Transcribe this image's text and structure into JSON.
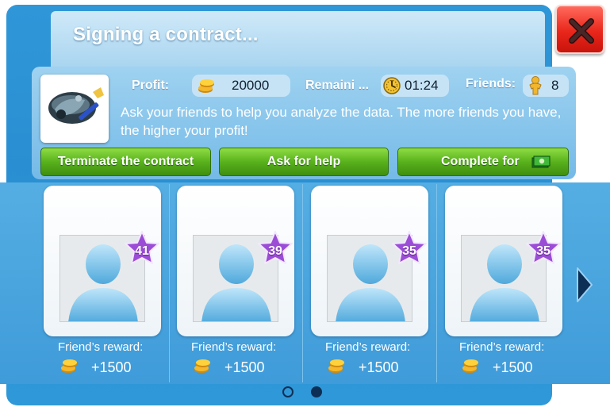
{
  "dialog": {
    "title": "Signing a contract...",
    "close_icon": "close-x-icon"
  },
  "info": {
    "profit_label": "Profit:",
    "profit_value": "20000",
    "remaining_label": "Remaini ...",
    "remaining_time": "01:24",
    "friends_label": "Friends:",
    "friends_count": "8",
    "description": "Ask your friends to help you analyze the data. The more friends you have, the higher your profit!"
  },
  "buttons": {
    "terminate": "Terminate the contract",
    "ask_help": "Ask for help",
    "complete": "Complete for"
  },
  "friends": [
    {
      "level": "41",
      "reward_label": "Friend’s reward:",
      "reward": "+1500"
    },
    {
      "level": "39",
      "reward_label": "Friend’s reward:",
      "reward": "+1500"
    },
    {
      "level": "35",
      "reward_label": "Friend’s reward:",
      "reward": "+1500"
    },
    {
      "level": "35",
      "reward_label": "Friend’s reward:",
      "reward": "+1500"
    }
  ],
  "pagination": {
    "pages": 2,
    "current": 2
  },
  "colors": {
    "panel_blue": "#2f97d8",
    "button_green": "#58b21c",
    "close_red": "#e9261b",
    "star_purple": "#9b4dd6"
  }
}
